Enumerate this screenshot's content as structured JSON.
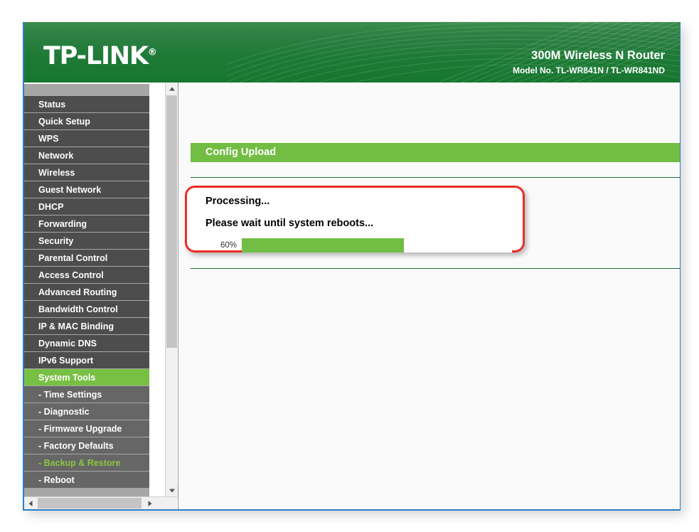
{
  "header": {
    "logo_text": "TP-LINK",
    "logo_registered": "®",
    "product_title": "300M Wireless N Router",
    "model_label": "Model No. TL-WR841N / TL-WR841ND",
    "brand_green": "#1c7a35"
  },
  "sidebar": {
    "items": [
      {
        "label": "Status",
        "type": "top",
        "state": "normal"
      },
      {
        "label": "Quick Setup",
        "type": "top",
        "state": "normal"
      },
      {
        "label": "WPS",
        "type": "top",
        "state": "normal"
      },
      {
        "label": "Network",
        "type": "top",
        "state": "normal"
      },
      {
        "label": "Wireless",
        "type": "top",
        "state": "normal"
      },
      {
        "label": "Guest Network",
        "type": "top",
        "state": "normal"
      },
      {
        "label": "DHCP",
        "type": "top",
        "state": "normal"
      },
      {
        "label": "Forwarding",
        "type": "top",
        "state": "normal"
      },
      {
        "label": "Security",
        "type": "top",
        "state": "normal"
      },
      {
        "label": "Parental Control",
        "type": "top",
        "state": "normal"
      },
      {
        "label": "Access Control",
        "type": "top",
        "state": "normal"
      },
      {
        "label": "Advanced Routing",
        "type": "top",
        "state": "normal"
      },
      {
        "label": "Bandwidth Control",
        "type": "top",
        "state": "normal"
      },
      {
        "label": "IP & MAC Binding",
        "type": "top",
        "state": "normal"
      },
      {
        "label": "Dynamic DNS",
        "type": "top",
        "state": "normal"
      },
      {
        "label": "IPv6 Support",
        "type": "top",
        "state": "normal"
      },
      {
        "label": "System Tools",
        "type": "top",
        "state": "active"
      },
      {
        "label": "- Time Settings",
        "type": "sub",
        "state": "normal"
      },
      {
        "label": "- Diagnostic",
        "type": "sub",
        "state": "normal"
      },
      {
        "label": "- Firmware Upgrade",
        "type": "sub",
        "state": "normal"
      },
      {
        "label": "- Factory Defaults",
        "type": "sub",
        "state": "normal"
      },
      {
        "label": "- Backup & Restore",
        "type": "sub",
        "state": "selected"
      },
      {
        "label": "- Reboot",
        "type": "sub",
        "state": "normal"
      }
    ],
    "active_color": "#78c043",
    "selected_text_color": "#8cc63e"
  },
  "main": {
    "page_title": "Config Upload",
    "processing_text": "Processing...",
    "wait_text": "Please wait until system reboots...",
    "progress_label": "60%",
    "progress_percent": 60,
    "progress_color": "#72bd44",
    "annotation_color": "#ec2d27"
  },
  "scrollbars": {
    "vertical_up_icon": "arrow-up-icon",
    "vertical_down_icon": "arrow-down-icon",
    "horizontal_left_icon": "arrow-left-icon",
    "horizontal_right_icon": "arrow-right-icon"
  }
}
